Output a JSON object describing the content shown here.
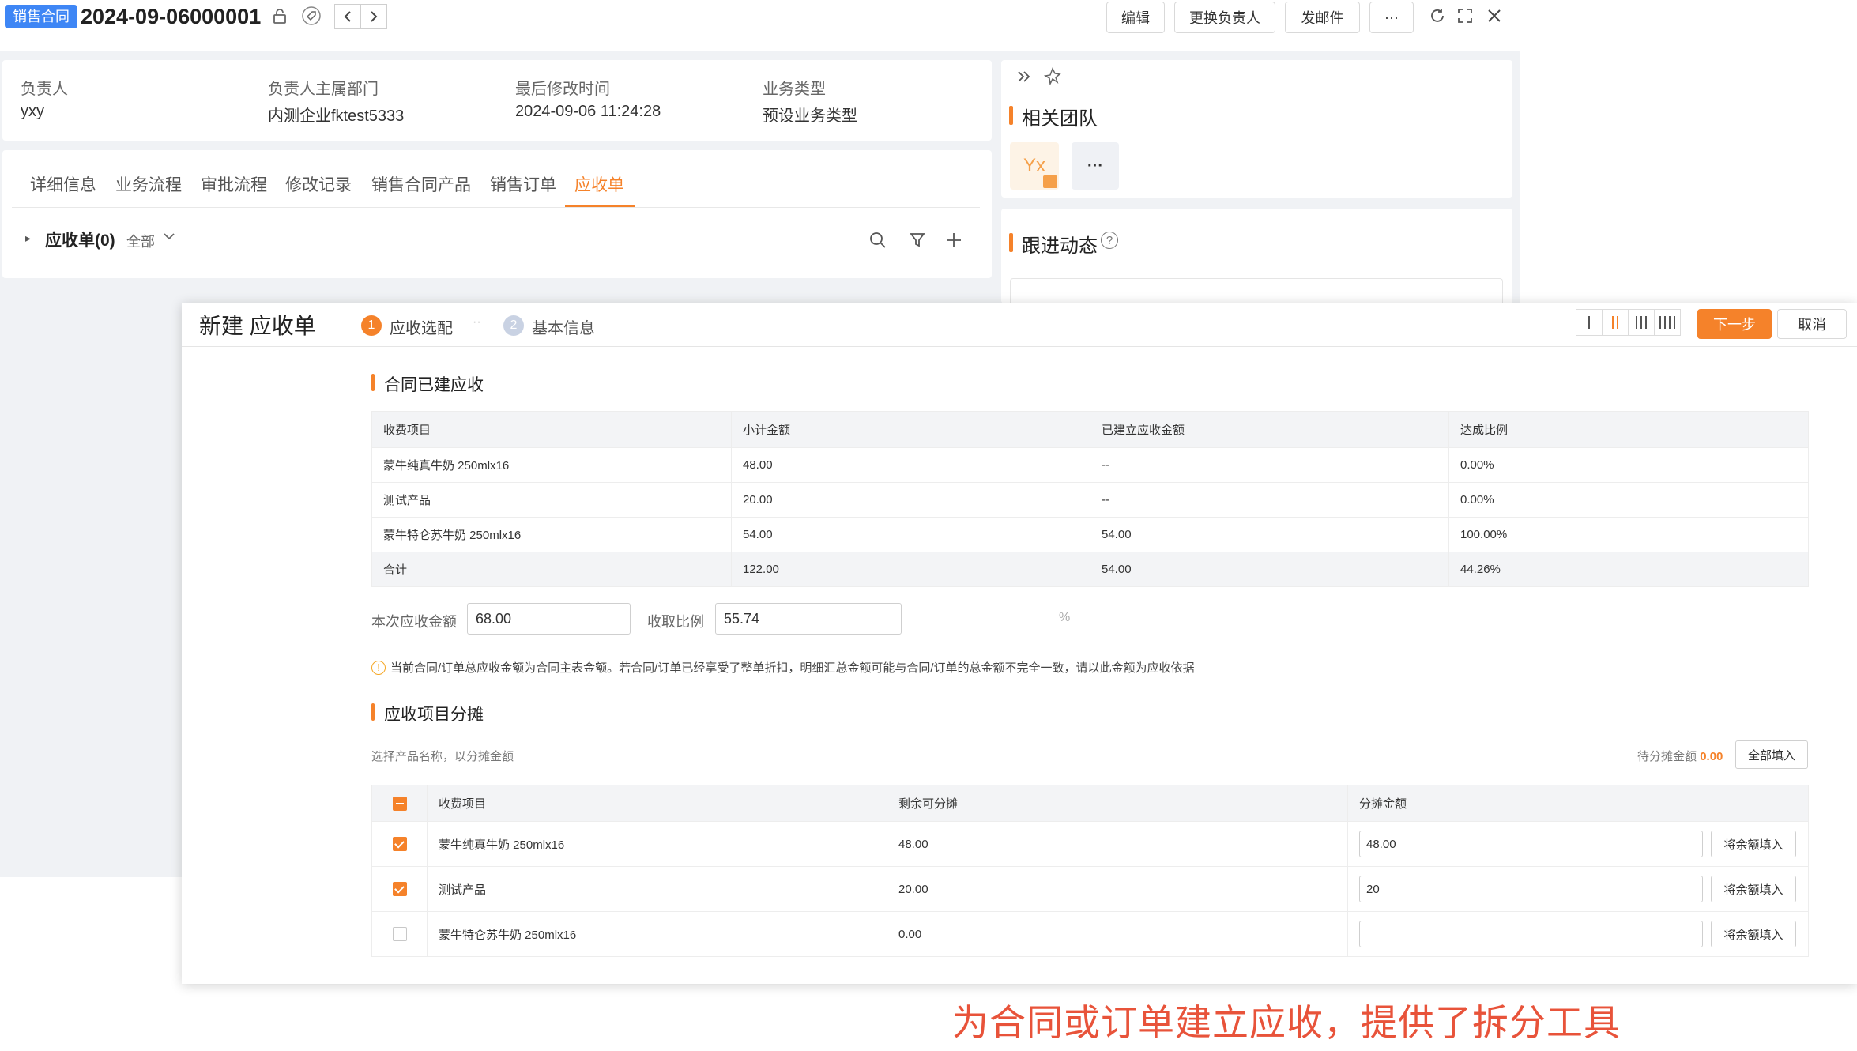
{
  "record": {
    "tag": "销售合同",
    "title": "2024-09-06000001",
    "buttons": {
      "edit": "编辑",
      "change_owner": "更换负责人",
      "send_mail": "发邮件",
      "more": "···"
    },
    "info": [
      {
        "label": "负责人",
        "value": "yxy"
      },
      {
        "label": "负责人主属部门",
        "value": "内测企业fktest5333"
      },
      {
        "label": "最后修改时间",
        "value": "2024-09-06 11:24:28"
      },
      {
        "label": "业务类型",
        "value": "预设业务类型"
      }
    ],
    "tabs": [
      "详细信息",
      "业务流程",
      "审批流程",
      "修改记录",
      "销售合同产品",
      "销售订单",
      "应收单"
    ],
    "active_tab": "应收单",
    "receivable_header": "应收单(0)",
    "filter_label": "全部",
    "side": {
      "team_title": "相关团队",
      "avatar": "Yx",
      "more": "···",
      "follow_title": "跟进动态"
    }
  },
  "modal": {
    "title": "新建 应收单",
    "steps": [
      {
        "num": "1",
        "label": "应收选配"
      },
      {
        "num": "2",
        "label": "基本信息"
      }
    ],
    "step_separator": "··",
    "next": "下一步",
    "cancel": "取消",
    "section1": "合同已建应收",
    "table1": {
      "headers": [
        "收费项目",
        "小计金额",
        "已建立应收金额",
        "达成比例"
      ],
      "rows": [
        [
          "蒙牛纯真牛奶 250mlx16",
          "48.00",
          "--",
          "0.00%"
        ],
        [
          "测试产品",
          "20.00",
          "--",
          "0.00%"
        ],
        [
          "蒙牛特仑苏牛奶 250mlx16",
          "54.00",
          "54.00",
          "100.00%"
        ]
      ],
      "total": [
        "合计",
        "122.00",
        "54.00",
        "44.26%"
      ]
    },
    "amount_label": "本次应收金额",
    "amount_value": "68.00",
    "ratio_label": "收取比例",
    "ratio_value": "55.74",
    "ratio_unit": "%",
    "notice": "当前合同/订单总应收金额为合同主表金额。若合同/订单已经享受了整单折扣，明细汇总金额可能与合同/订单的总金额不完全一致，请以此金额为应收依据",
    "section2": "应收项目分摊",
    "hint": "选择产品名称，以分摊金额",
    "pending_label": "待分摊金额",
    "pending_value": "0.00",
    "fill_all": "全部填入",
    "table2": {
      "headers": [
        "收费项目",
        "剩余可分摊",
        "分摊金额"
      ],
      "rows": [
        {
          "name": "蒙牛纯真牛奶 250mlx16",
          "remain": "48.00",
          "alloc": "48.00",
          "checked": true
        },
        {
          "name": "测试产品",
          "remain": "20.00",
          "alloc": "20",
          "checked": true
        },
        {
          "name": "蒙牛特仑苏牛奶 250mlx16",
          "remain": "0.00",
          "alloc": "",
          "checked": false
        }
      ],
      "fill_button": "将余额填入"
    }
  },
  "caption": "为合同或订单建立应收，提供了拆分工具",
  "colors": {
    "accent": "#f5822a",
    "tag": "#3e86f5",
    "caption": "#e8533a"
  }
}
